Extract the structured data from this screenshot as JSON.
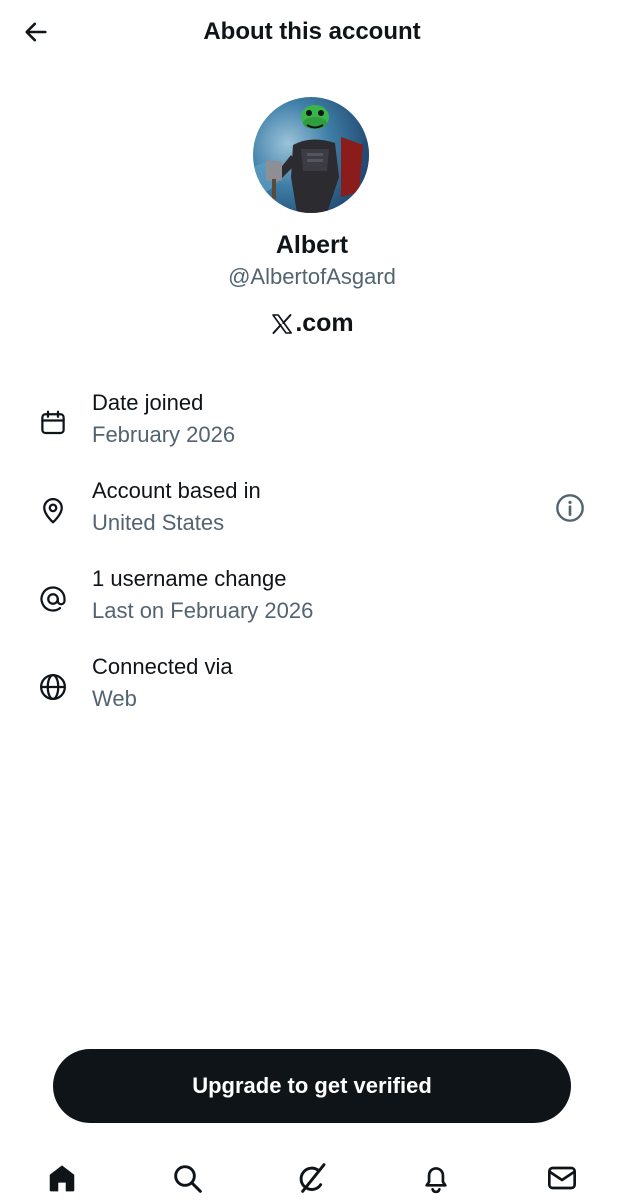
{
  "header": {
    "title": "About this account",
    "back_icon": "arrow-left-icon"
  },
  "profile": {
    "display_name": "Albert",
    "handle": "@AlbertofAsgard",
    "site_suffix": ".com",
    "site_logo_icon": "x-logo-icon"
  },
  "info_rows": [
    {
      "icon": "calendar-icon",
      "label": "Date joined",
      "value": "February 2026"
    },
    {
      "icon": "location-pin-icon",
      "label": "Account based in",
      "value": "United States",
      "action_icon": "info-icon"
    },
    {
      "icon": "at-sign-icon",
      "label": "1 username change",
      "value": "Last on February 2026"
    },
    {
      "icon": "globe-icon",
      "label": "Connected via",
      "value": "Web"
    }
  ],
  "upgrade_button": {
    "label": "Upgrade to get verified"
  },
  "bottom_nav": [
    {
      "icon": "home-icon"
    },
    {
      "icon": "search-icon"
    },
    {
      "icon": "grok-icon"
    },
    {
      "icon": "bell-icon"
    },
    {
      "icon": "mail-icon"
    }
  ],
  "colors": {
    "text_primary": "#0f1419",
    "text_secondary": "#536471",
    "button_background": "#0f1419",
    "background": "#ffffff"
  }
}
